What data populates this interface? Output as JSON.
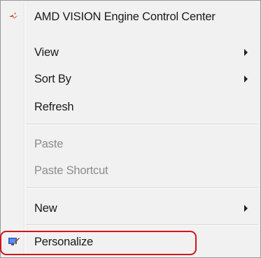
{
  "context_menu": {
    "items": [
      {
        "label": "AMD VISION Engine Control Center",
        "icon": "amd-icon",
        "enabled": true,
        "submenu": false
      },
      {
        "label": "View",
        "enabled": true,
        "submenu": true
      },
      {
        "label": "Sort By",
        "enabled": true,
        "submenu": true
      },
      {
        "label": "Refresh",
        "enabled": true,
        "submenu": false
      },
      {
        "label": "Paste",
        "enabled": false,
        "submenu": false
      },
      {
        "label": "Paste Shortcut",
        "enabled": false,
        "submenu": false
      },
      {
        "label": "New",
        "enabled": true,
        "submenu": true
      },
      {
        "label": "Personalize",
        "icon": "personalize-icon",
        "enabled": true,
        "submenu": false,
        "highlighted": true
      }
    ]
  },
  "colors": {
    "menu_background": "#f1f1f1",
    "disabled_text": "#8c8c8c",
    "highlight_border": "#d2141e"
  }
}
